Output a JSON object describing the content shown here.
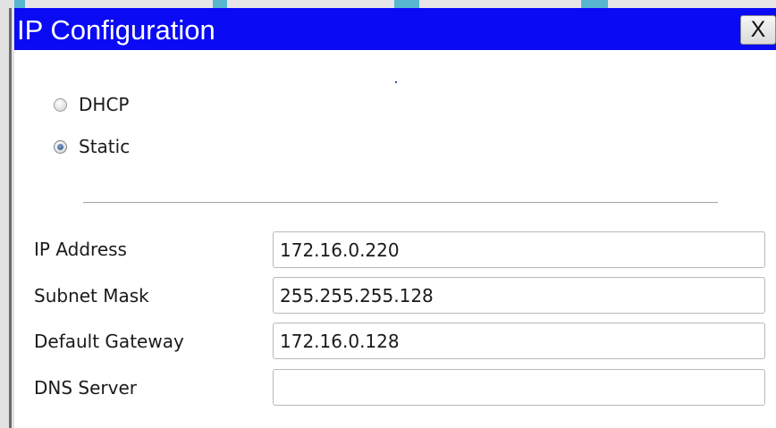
{
  "window": {
    "title": "IP Configuration",
    "close_label": "X"
  },
  "mode": {
    "options": [
      {
        "label": "DHCP",
        "selected": false
      },
      {
        "label": "Static",
        "selected": true
      }
    ]
  },
  "fields": [
    {
      "label": "IP Address",
      "value": "172.16.0.220"
    },
    {
      "label": "Subnet Mask",
      "value": "255.255.255.128"
    },
    {
      "label": "Default Gateway",
      "value": "172.16.0.128"
    },
    {
      "label": "DNS Server",
      "value": ""
    }
  ],
  "colors": {
    "titlebar": "#0a0af5",
    "accent_strip": "#58b6cf"
  }
}
